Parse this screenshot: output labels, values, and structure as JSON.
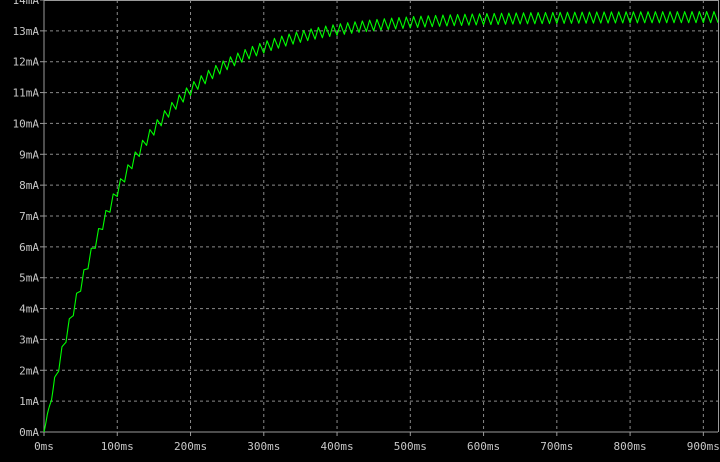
{
  "colors": {
    "background": "#000000",
    "grid": "#8a8a8a",
    "axis": "#9a9a9a",
    "tick_label": "#c8c8c8",
    "trace": "#00ff00"
  },
  "chart_data": {
    "type": "line",
    "title": "",
    "xlabel": "",
    "ylabel": "",
    "xlim": [
      0,
      920
    ],
    "ylim": [
      0,
      14
    ],
    "x_ticks": [
      0,
      100,
      200,
      300,
      400,
      500,
      600,
      700,
      800,
      900
    ],
    "x_tick_labels": [
      "0ms",
      "100ms",
      "200ms",
      "300ms",
      "400ms",
      "500ms",
      "600ms",
      "700ms",
      "800ms",
      "900ms"
    ],
    "y_ticks": [
      0,
      1,
      2,
      3,
      4,
      5,
      6,
      7,
      8,
      9,
      10,
      11,
      12,
      13,
      14
    ],
    "y_tick_labels": [
      "0mA",
      "1mA",
      "2mA",
      "3mA",
      "4mA",
      "5mA",
      "6mA",
      "7mA",
      "8mA",
      "9mA",
      "10mA",
      "11mA",
      "12mA",
      "13mA",
      "14mA"
    ],
    "grid": true,
    "grid_style": "dashed",
    "legend": "none",
    "series": [
      {
        "color": "#00ff00",
        "envelope_time_constant_ms": 115,
        "final_value": 13.45,
        "ripple_period_ms": 10,
        "ripple_amplitude": 0.18,
        "x": [
          0,
          25,
          50,
          75,
          100,
          125,
          150,
          175,
          200,
          250,
          300,
          350,
          400,
          450,
          500,
          550,
          600,
          650,
          700,
          750,
          800,
          850,
          900,
          920
        ],
        "y": [
          0.0,
          2.6,
          4.9,
          6.6,
          8.2,
          9.3,
          10.3,
          11.0,
          11.7,
          12.5,
          13.0,
          13.2,
          13.3,
          13.38,
          13.41,
          13.43,
          13.44,
          13.45,
          13.45,
          13.45,
          13.45,
          13.45,
          13.45,
          13.45
        ]
      }
    ]
  }
}
